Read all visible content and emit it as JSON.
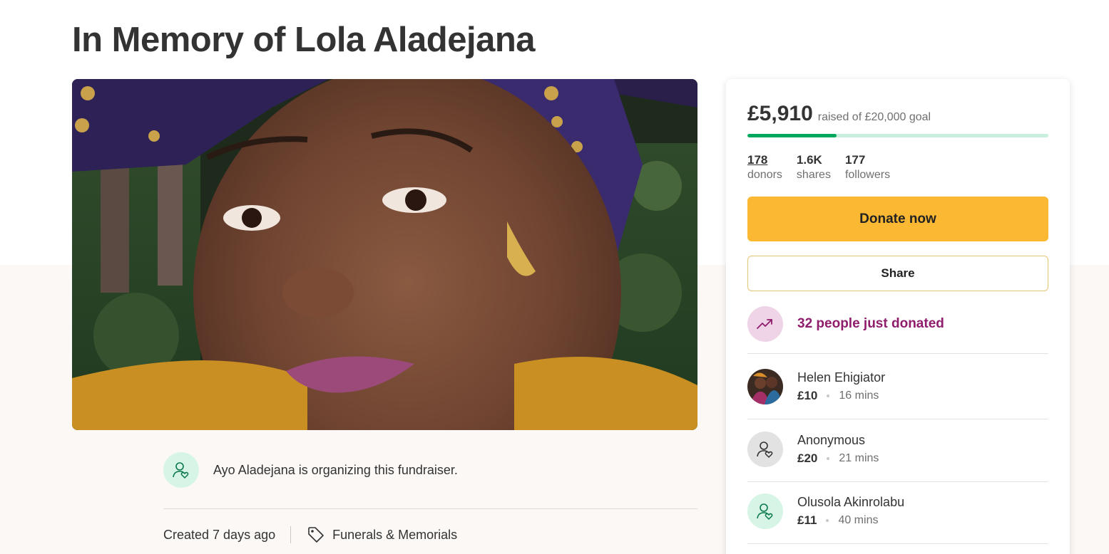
{
  "page": {
    "title": "In Memory of Lola Aladejana"
  },
  "organizer": {
    "text": "Ayo Aladejana is organizing this fundraiser."
  },
  "meta": {
    "created": "Created 7 days ago",
    "category": "Funerals & Memorials"
  },
  "card": {
    "raised_amount": "£5,910",
    "raised_goal": "raised of £20,000 goal",
    "progress_fraction": 0.2955,
    "stats": [
      {
        "value": "178",
        "label": "donors"
      },
      {
        "value": "1.6K",
        "label": "shares"
      },
      {
        "value": "177",
        "label": "followers"
      }
    ],
    "donate_label": "Donate now",
    "share_label": "Share",
    "recent_label": "32 people just donated"
  },
  "donors": [
    {
      "name": "Helen Ehigiator",
      "amount": "£10",
      "time": "16 mins"
    },
    {
      "name": "Anonymous",
      "amount": "£20",
      "time": "21 mins"
    },
    {
      "name": "Olusola Akinrolabu",
      "amount": "£11",
      "time": "40 mins"
    }
  ],
  "colors": {
    "accent_green": "#02a95c",
    "donate_yellow": "#fbb833",
    "recent_purple": "#8f1d6b"
  }
}
